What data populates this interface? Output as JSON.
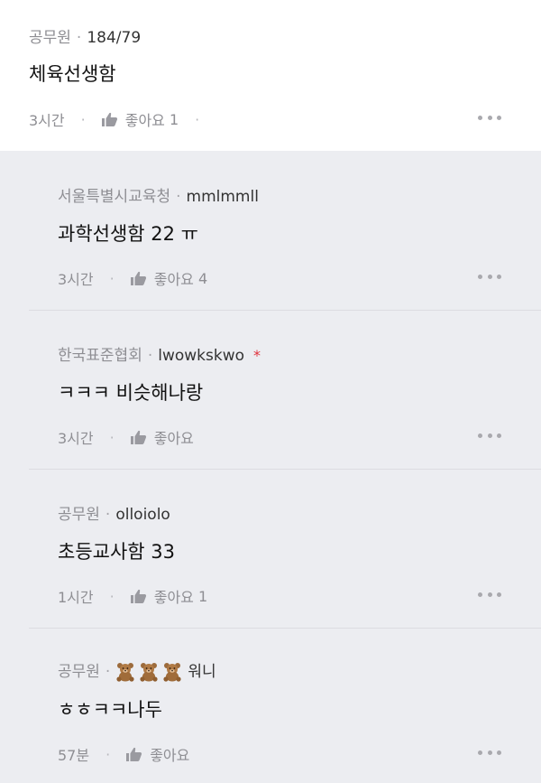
{
  "post": {
    "author": "공무원",
    "nick": "184/79",
    "content": "체육선생함",
    "time": "3시간",
    "like_label": "좋아요",
    "like_count": "1"
  },
  "replies": [
    {
      "author": "서울특별시교육청",
      "nick": "mmlmmll",
      "content": "과학선생함 22 ㅠ",
      "time": "3시간",
      "like_label": "좋아요",
      "like_count": "4"
    },
    {
      "author": "한국표준협회",
      "nick": "lwowkskwo",
      "star": "*",
      "content": "ㅋㅋㅋ 비슷해나랑",
      "time": "3시간",
      "like_label": "좋아요",
      "like_count": ""
    },
    {
      "author": "공무원",
      "nick": "olloiolo",
      "content": "초등교사함 33",
      "time": "1시간",
      "like_label": "좋아요",
      "like_count": "1"
    },
    {
      "author": "공무원",
      "nick": "워니",
      "bears": 3,
      "content": "ㅎㅎㅋㅋ나두",
      "time": "57분",
      "like_label": "좋아요",
      "like_count": ""
    }
  ],
  "colors": {
    "background_replies": "#ecedf1",
    "meta_text": "#8e8e93",
    "star": "#e0323c"
  },
  "icons": {
    "like": "thumbs-up-icon",
    "more": "more-dots-icon",
    "bear": "teddy-bear-emoji"
  }
}
